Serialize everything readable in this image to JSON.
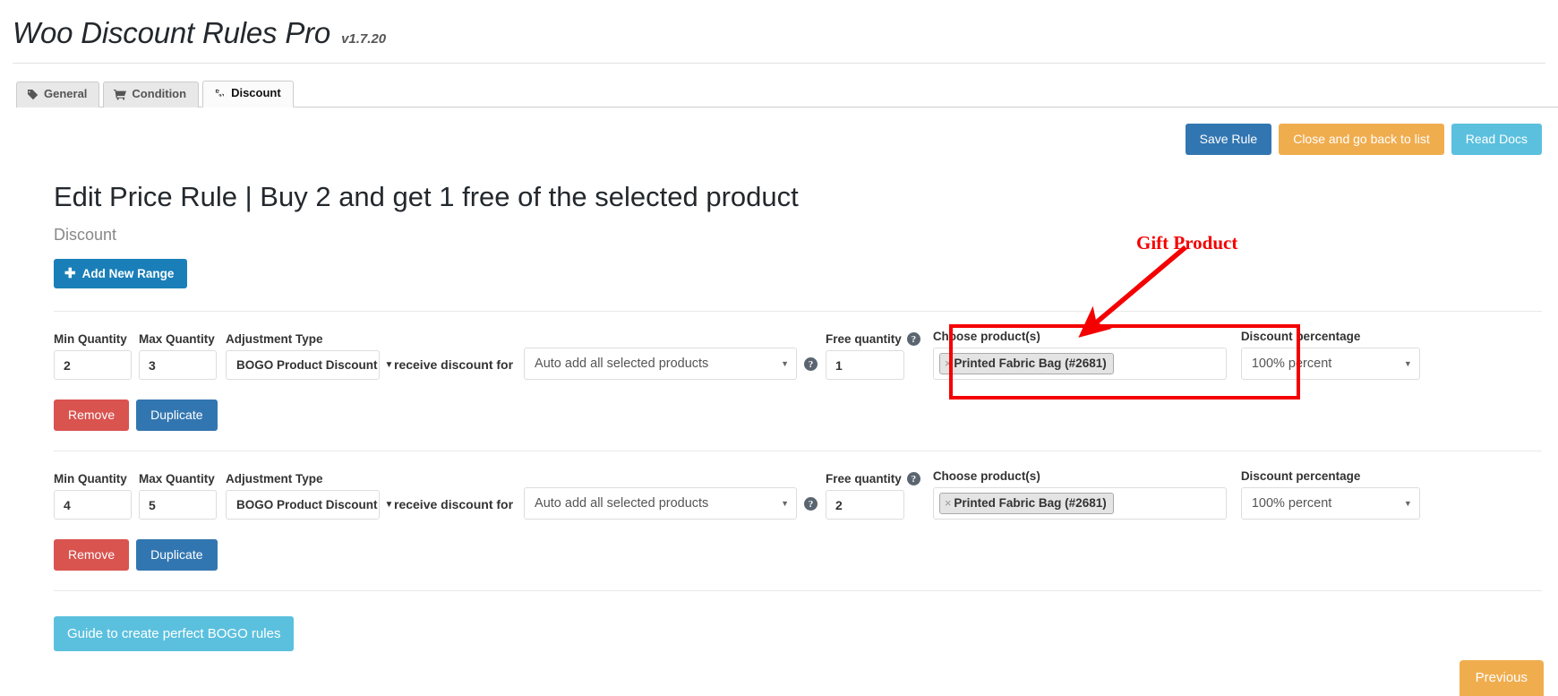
{
  "app": {
    "title": "Woo Discount Rules Pro",
    "version": "v1.7.20"
  },
  "tabs": [
    {
      "label": "General",
      "icon": "tag-icon",
      "active": false
    },
    {
      "label": "Condition",
      "icon": "cart-icon",
      "active": false
    },
    {
      "label": "Discount",
      "icon": "cogs-icon",
      "active": true
    }
  ],
  "actions": {
    "save": "Save Rule",
    "close": "Close and go back to list",
    "docs": "Read Docs"
  },
  "page": {
    "heading": "Edit Price Rule | Buy 2 and get 1 free of the selected product",
    "subheading": "Discount",
    "add_range": "Add New Range",
    "add_range_icon": "plus-icon"
  },
  "labels": {
    "min_quantity": "Min Quantity",
    "max_quantity": "Max Quantity",
    "adjustment_type": "Adjustment Type",
    "receive_discount_for": "receive discount for",
    "free_quantity": "Free quantity",
    "choose_products": "Choose product(s)",
    "discount_percentage": "Discount percentage",
    "remove": "Remove",
    "duplicate": "Duplicate",
    "help_icon": "help-icon",
    "caret_icon": "chevron-down-icon",
    "remove-token-icon": "close-icon"
  },
  "rows": [
    {
      "min_quantity": "2",
      "max_quantity": "3",
      "adjustment_type": "BOGO Product Discount",
      "receive_discount_for": "Auto add all selected products",
      "free_quantity": "1",
      "products": [
        "Printed Fabric Bag (#2681)"
      ],
      "discount_percentage": "100% percent"
    },
    {
      "min_quantity": "4",
      "max_quantity": "5",
      "adjustment_type": "BOGO Product Discount",
      "receive_discount_for": "Auto add all selected products",
      "free_quantity": "2",
      "products": [
        "Printed Fabric Bag (#2681)"
      ],
      "discount_percentage": "100% percent"
    }
  ],
  "annotation": {
    "label": "Gift Product",
    "color": "#f40000"
  },
  "footer": {
    "guide": "Guide to create perfect BOGO rules",
    "previous": "Previous"
  }
}
